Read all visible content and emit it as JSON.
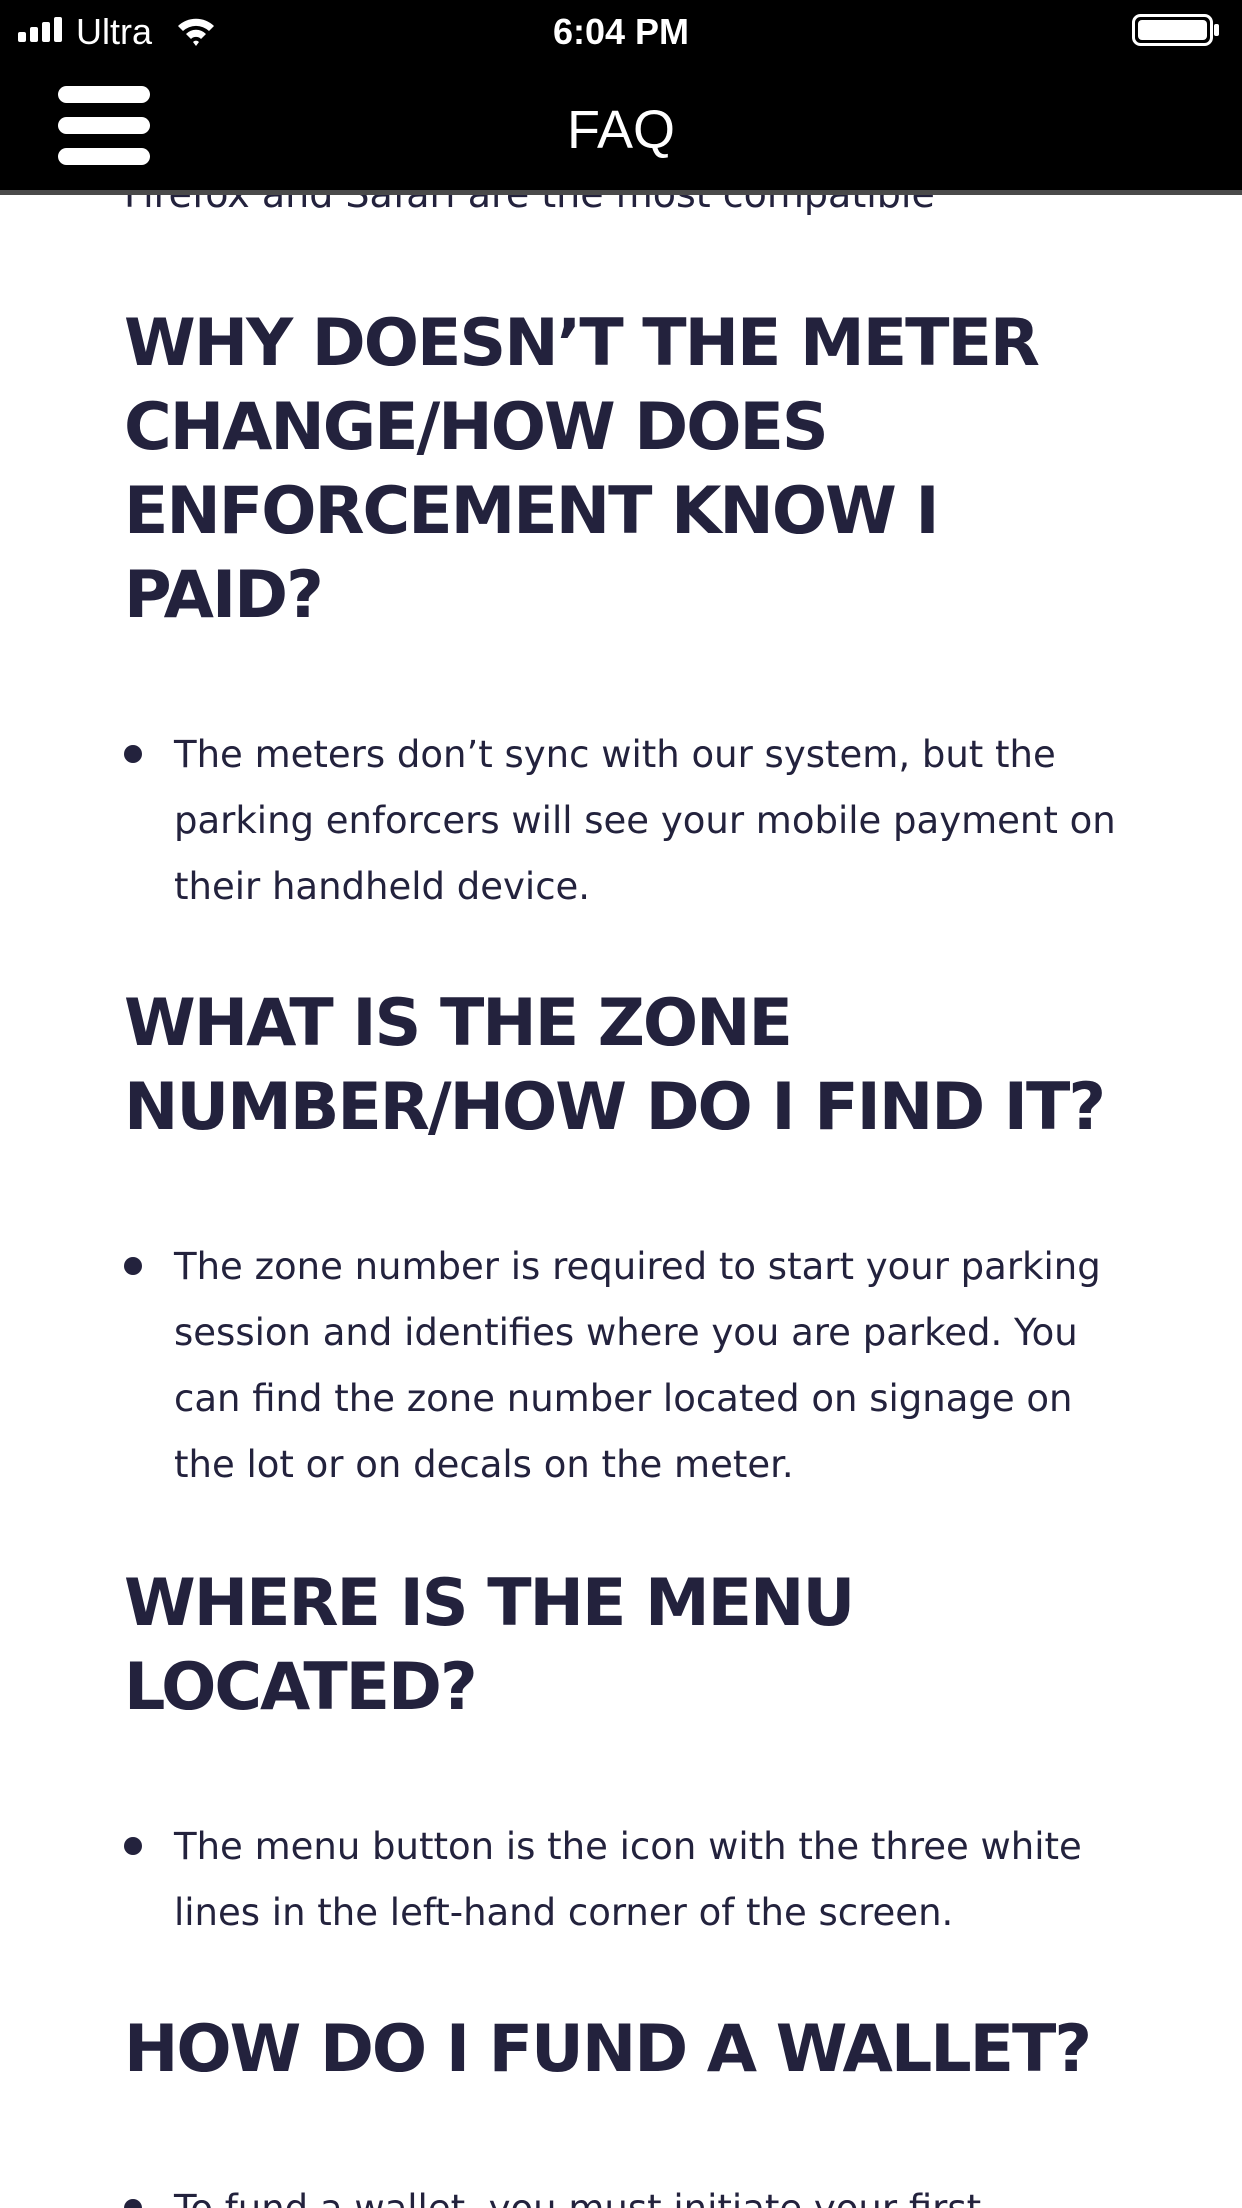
{
  "status_bar": {
    "carrier": "Ultra",
    "time": "6:04 PM",
    "signal_icon": "signal-bars-icon",
    "wifi_icon": "wifi-icon",
    "battery_icon": "battery-icon"
  },
  "header": {
    "title": "FAQ",
    "menu_icon": "hamburger-menu-icon",
    "background": "#000000",
    "text_color": "#ffffff"
  },
  "content": {
    "cut_off_text": "Firefox and Safari are the most compatible",
    "text_color": "#23223d",
    "faqs": [
      {
        "question": "WHY DOESN’T THE METER CHANGE/HOW DOES ENFORCEMENT KNOW I PAID?",
        "answer": "The meters don’t sync with our system, but the parking enforcers will see your mobile payment on their handheld device."
      },
      {
        "question": "WHAT IS THE ZONE NUMBER/HOW DO I FIND IT?",
        "answer": "The zone number is required to start your parking session and identifies where you are parked. You can find the zone number located on signage on the lot or on decals on the meter."
      },
      {
        "question": "WHERE IS THE MENU LOCATED?",
        "answer": "The menu button is the icon with the three white lines in the left-hand corner of the screen."
      },
      {
        "question": "HOW DO I FUND A WALLET?",
        "answer": "To fund a wallet, you must initiate your first"
      }
    ]
  }
}
